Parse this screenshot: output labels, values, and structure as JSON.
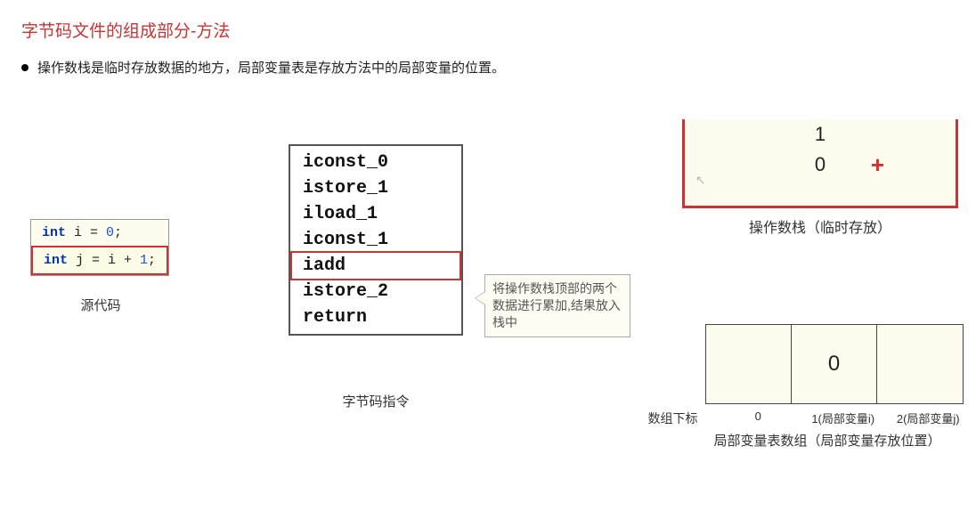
{
  "title": "字节码文件的组成部分-方法",
  "bullet": "操作数栈是临时存放数据的地方，局部变量表是存放方法中的局部变量的位置。",
  "source": {
    "line1_kw": "int",
    "line1_rest": " i = ",
    "line1_num": "0",
    "line1_end": ";",
    "line2_kw": "int",
    "line2_rest": " j = i + ",
    "line2_num": "1",
    "line2_end": ";",
    "caption": "源代码"
  },
  "bytecode": {
    "lines": [
      "iconst_0",
      "istore_1",
      "iload_1",
      "iconst_1",
      "iadd",
      "istore_2",
      "return"
    ],
    "highlight": "iadd",
    "caption": "字节码指令"
  },
  "callout": "将操作数栈顶部的两个数据进行累加,结果放入栈中",
  "stack": {
    "items": [
      "1",
      "0"
    ],
    "plus": "+",
    "caption": "操作数栈（临时存放）"
  },
  "lvt": {
    "cells": [
      "",
      "0",
      ""
    ],
    "index_label": "数组下标",
    "indices": [
      "0",
      "1(局部变量i)",
      "2(局部变量j)"
    ],
    "caption": "局部变量表数组（局部变量存放位置）"
  }
}
